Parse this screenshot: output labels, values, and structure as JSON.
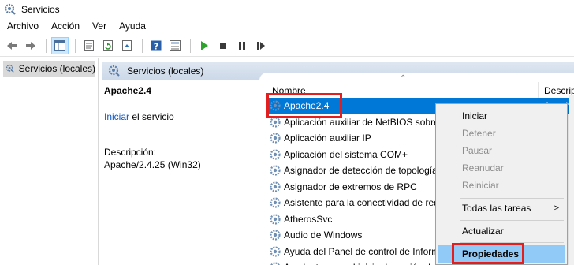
{
  "window": {
    "title": "Servicios",
    "icon": "services-gear-icon"
  },
  "menu": [
    "Archivo",
    "Acción",
    "Ver",
    "Ayuda"
  ],
  "toolbar": {
    "buttons": [
      "back-arrow-icon",
      "forward-arrow-icon",
      "console-tree-icon",
      "properties-sheet-icon",
      "refresh-icon",
      "export-list-icon",
      "help-icon",
      "mmc-view-icon",
      "start-play-icon",
      "stop-icon",
      "pause-icon",
      "restart-icon"
    ],
    "play_color": "#2da32d"
  },
  "tree": {
    "item_label": "Servicios (locales)"
  },
  "panel": {
    "header_label": "Servicios (locales)"
  },
  "detail": {
    "service_name": "Apache2.4",
    "start_link": "Iniciar",
    "start_suffix": " el servicio",
    "description_label": "Descripción:",
    "description_value": "Apache/2.4.25 (Win32)"
  },
  "list": {
    "columns": {
      "name": "Nombre",
      "description": "Descrip"
    },
    "rows": [
      {
        "name": "Apache2.4",
        "desc": "Apache"
      },
      {
        "name": "Aplicación auxiliar de NetBIOS sobre TCP/IP",
        "desc": ""
      },
      {
        "name": "Aplicación auxiliar IP",
        "desc": ""
      },
      {
        "name": "Aplicación del sistema COM+",
        "desc": ""
      },
      {
        "name": "Asignador de detección de topología",
        "desc": ""
      },
      {
        "name": "Asignador de extremos de RPC",
        "desc": ""
      },
      {
        "name": "Asistente para la conectividad de red",
        "desc": ""
      },
      {
        "name": "AtherosSvc",
        "desc": ""
      },
      {
        "name": "Audio de Windows",
        "desc": ""
      },
      {
        "name": "Ayuda del Panel de control de Informes",
        "desc": ""
      },
      {
        "name": "Ayudante para el inicio de sesión de cuenta",
        "desc": ""
      }
    ],
    "selected_color": "#0078d7"
  },
  "context_menu": {
    "start": "Iniciar",
    "stop": "Detener",
    "pause": "Pausar",
    "resume": "Reanudar",
    "restart": "Reiniciar",
    "all_tasks": "Todas las tareas",
    "refresh": "Actualizar",
    "properties": "Propiedades",
    "submenu_arrow": ">"
  },
  "highlight_color": "#e21e1e"
}
